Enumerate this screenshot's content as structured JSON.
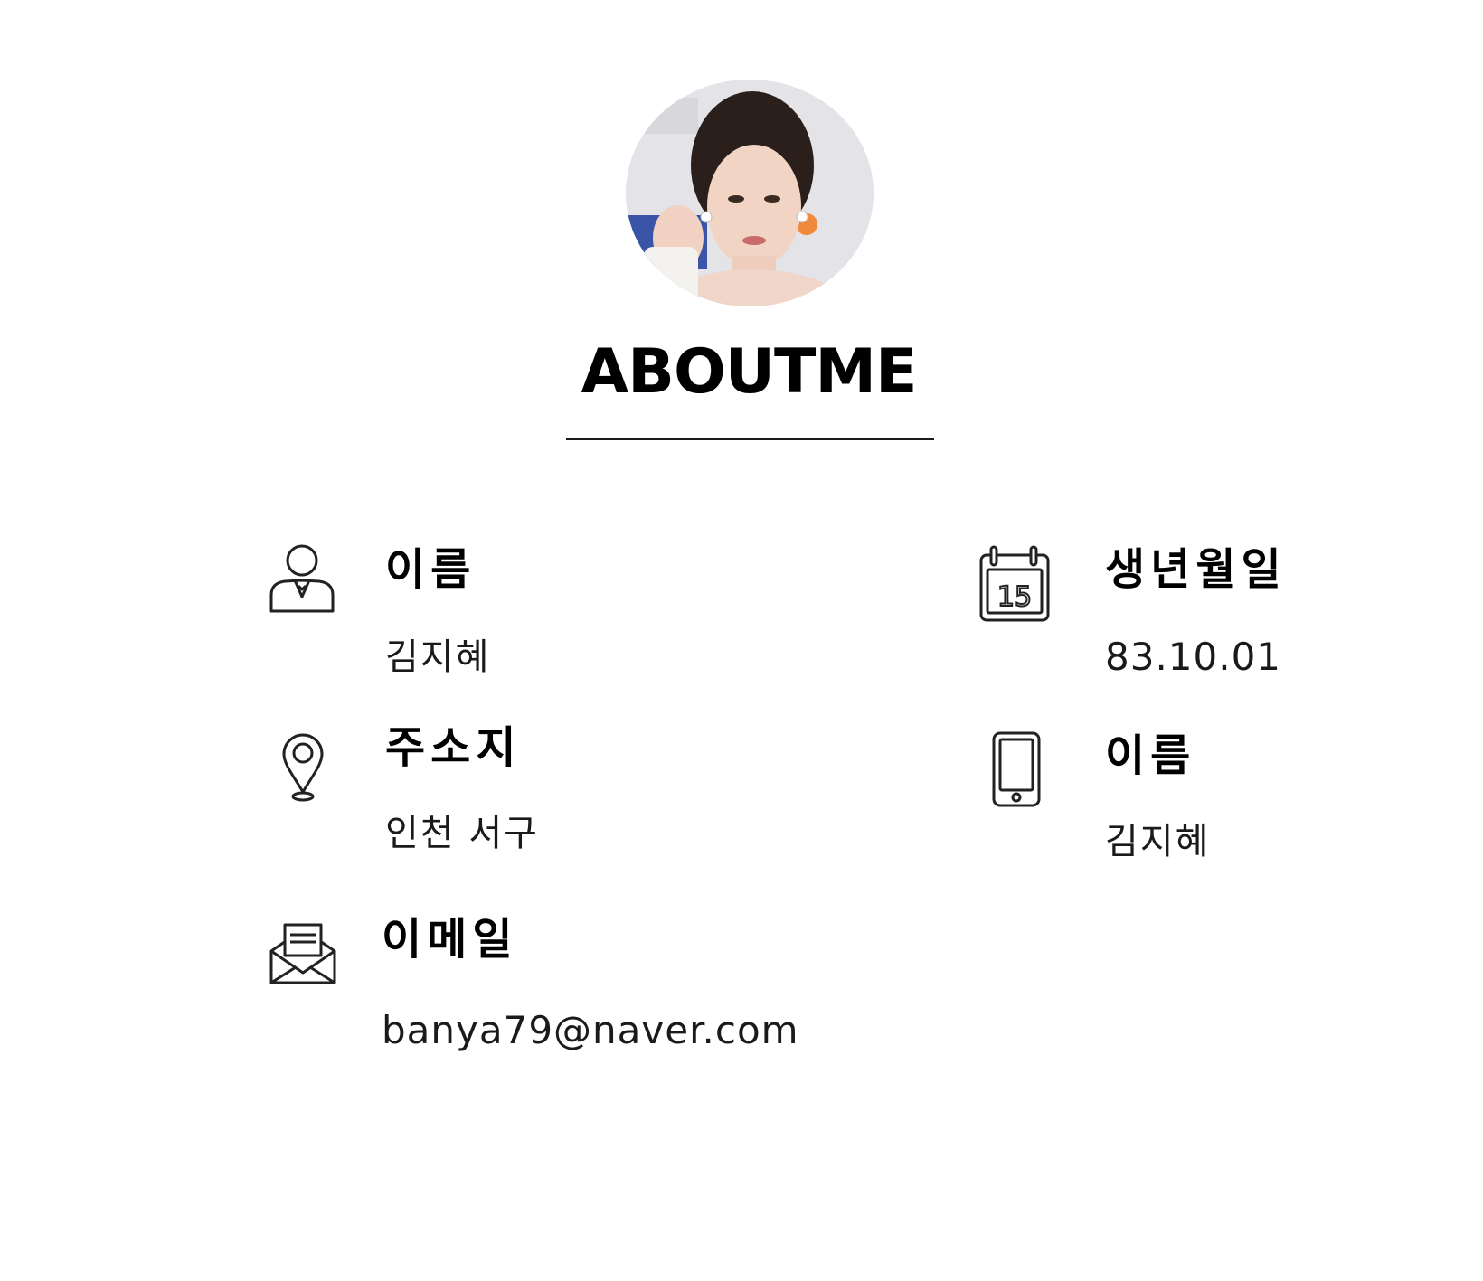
{
  "profile": {
    "title": "ABOUTME",
    "avatar_alt": "profile photo"
  },
  "info": {
    "name": {
      "icon": "person-icon",
      "label": "이름",
      "value": "김지혜"
    },
    "birthday": {
      "icon": "calendar-icon",
      "calendar_day": "15",
      "label": "생년월일",
      "value": "83.10.01"
    },
    "address": {
      "icon": "location-pin-icon",
      "label": "주소지",
      "value": "인천 서구"
    },
    "phone": {
      "icon": "smartphone-icon",
      "label": "이름",
      "value": "김지혜"
    },
    "email": {
      "icon": "envelope-icon",
      "label": "이메일",
      "value": "banya79@naver.com"
    }
  }
}
